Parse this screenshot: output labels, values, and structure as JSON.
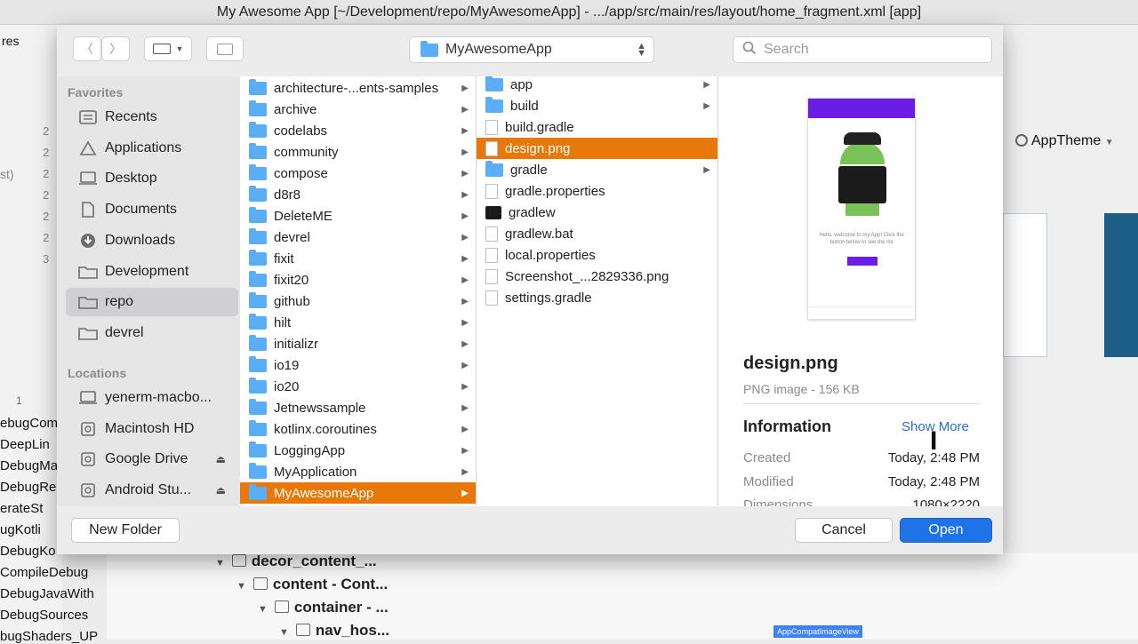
{
  "window": {
    "title": "My Awesome App [~/Development/repo/MyAwesomeApp] - .../app/src/main/res/layout/home_fragment.xml [app]"
  },
  "ide": {
    "left_top_label": "res",
    "left_tail": "st)",
    "gutter_numbers": [
      "2",
      "2",
      "2",
      "2",
      "2",
      "2",
      "3"
    ],
    "panel_number": "1",
    "left_lines": [
      "ebugCom",
      "DeepLin",
      "DebugMa",
      "DebugRe",
      "erateSt",
      "ugKotli",
      "DebugKo",
      "CompileDebug",
      "DebugJavaWith",
      "DebugSources",
      "bugShaders_UP"
    ],
    "theme_label": "AppTheme",
    "tree_rows": [
      "decor_content_...",
      "content - Cont...",
      "container - ...",
      "nav_hos..."
    ],
    "appcompat_label": "AppCompatImageView"
  },
  "toolbar": {
    "back_icon": "chevron-left-icon",
    "forward_icon": "chevron-right-icon",
    "view_icon": "column-view-icon",
    "new_folder_icon": "new-folder-icon",
    "path": "MyAwesomeApp",
    "search_placeholder": "Search"
  },
  "sidebar": {
    "favorites_heading": "Favorites",
    "favorites": [
      {
        "label": "Recents",
        "icon": "recents-icon"
      },
      {
        "label": "Applications",
        "icon": "applications-icon"
      },
      {
        "label": "Desktop",
        "icon": "desktop-icon"
      },
      {
        "label": "Documents",
        "icon": "documents-icon"
      },
      {
        "label": "Downloads",
        "icon": "downloads-icon"
      },
      {
        "label": "Development",
        "icon": "folder-icon"
      },
      {
        "label": "repo",
        "icon": "folder-icon",
        "selected": true
      },
      {
        "label": "devrel",
        "icon": "folder-icon"
      }
    ],
    "locations_heading": "Locations",
    "locations": [
      {
        "label": "yenerm-macbo...",
        "icon": "laptop-icon"
      },
      {
        "label": "Macintosh HD",
        "icon": "disk-icon"
      },
      {
        "label": "Google Drive",
        "icon": "disk-icon",
        "eject": true
      },
      {
        "label": "Android Stu...",
        "icon": "disk-icon",
        "eject": true
      }
    ]
  },
  "column1": [
    {
      "label": "architecture-...ents-samples",
      "selected": false
    },
    {
      "label": "archive",
      "selected": false
    },
    {
      "label": "codelabs",
      "selected": false
    },
    {
      "label": "community",
      "selected": false
    },
    {
      "label": "compose",
      "selected": false
    },
    {
      "label": "d8r8",
      "selected": false
    },
    {
      "label": "DeleteME",
      "selected": false
    },
    {
      "label": "devrel",
      "selected": false
    },
    {
      "label": "fixit",
      "selected": false
    },
    {
      "label": "fixit20",
      "selected": false
    },
    {
      "label": "github",
      "selected": false
    },
    {
      "label": "hilt",
      "selected": false
    },
    {
      "label": "initializr",
      "selected": false
    },
    {
      "label": "io19",
      "selected": false
    },
    {
      "label": "io20",
      "selected": false
    },
    {
      "label": "Jetnewssample",
      "selected": false
    },
    {
      "label": "kotlinx.coroutines",
      "selected": false
    },
    {
      "label": "LoggingApp",
      "selected": false
    },
    {
      "label": "MyApplication",
      "selected": false
    },
    {
      "label": "MyAwesomeApp",
      "selected": true
    }
  ],
  "column2": [
    {
      "label": "app",
      "type": "folder",
      "has_children": true
    },
    {
      "label": "build",
      "type": "folder",
      "has_children": true
    },
    {
      "label": "build.gradle",
      "type": "file"
    },
    {
      "label": "design.png",
      "type": "image",
      "selected": true
    },
    {
      "label": "gradle",
      "type": "folder",
      "has_children": true
    },
    {
      "label": "gradle.properties",
      "type": "file"
    },
    {
      "label": "gradlew",
      "type": "exec"
    },
    {
      "label": "gradlew.bat",
      "type": "file"
    },
    {
      "label": "local.properties",
      "type": "file"
    },
    {
      "label": "Screenshot_...2829336.png",
      "type": "image"
    },
    {
      "label": "settings.gradle",
      "type": "file"
    }
  ],
  "preview": {
    "thumb_text": "Hello, welcome to my App! Click the button below to see the list",
    "name": "design.png",
    "kind": "PNG image - 156 KB",
    "info_title": "Information",
    "show_more": "Show More",
    "created_label": "Created",
    "created_value": "Today, 2:48 PM",
    "modified_label": "Modified",
    "modified_value": "Today, 2:48 PM",
    "dimensions_label": "Dimensions",
    "dimensions_value": "1080×2220"
  },
  "footer": {
    "new_folder": "New Folder",
    "cancel": "Cancel",
    "open": "Open"
  },
  "colors": {
    "selection": "#e8780a",
    "accent": "#1f73e8",
    "folder": "#5aaef5"
  }
}
